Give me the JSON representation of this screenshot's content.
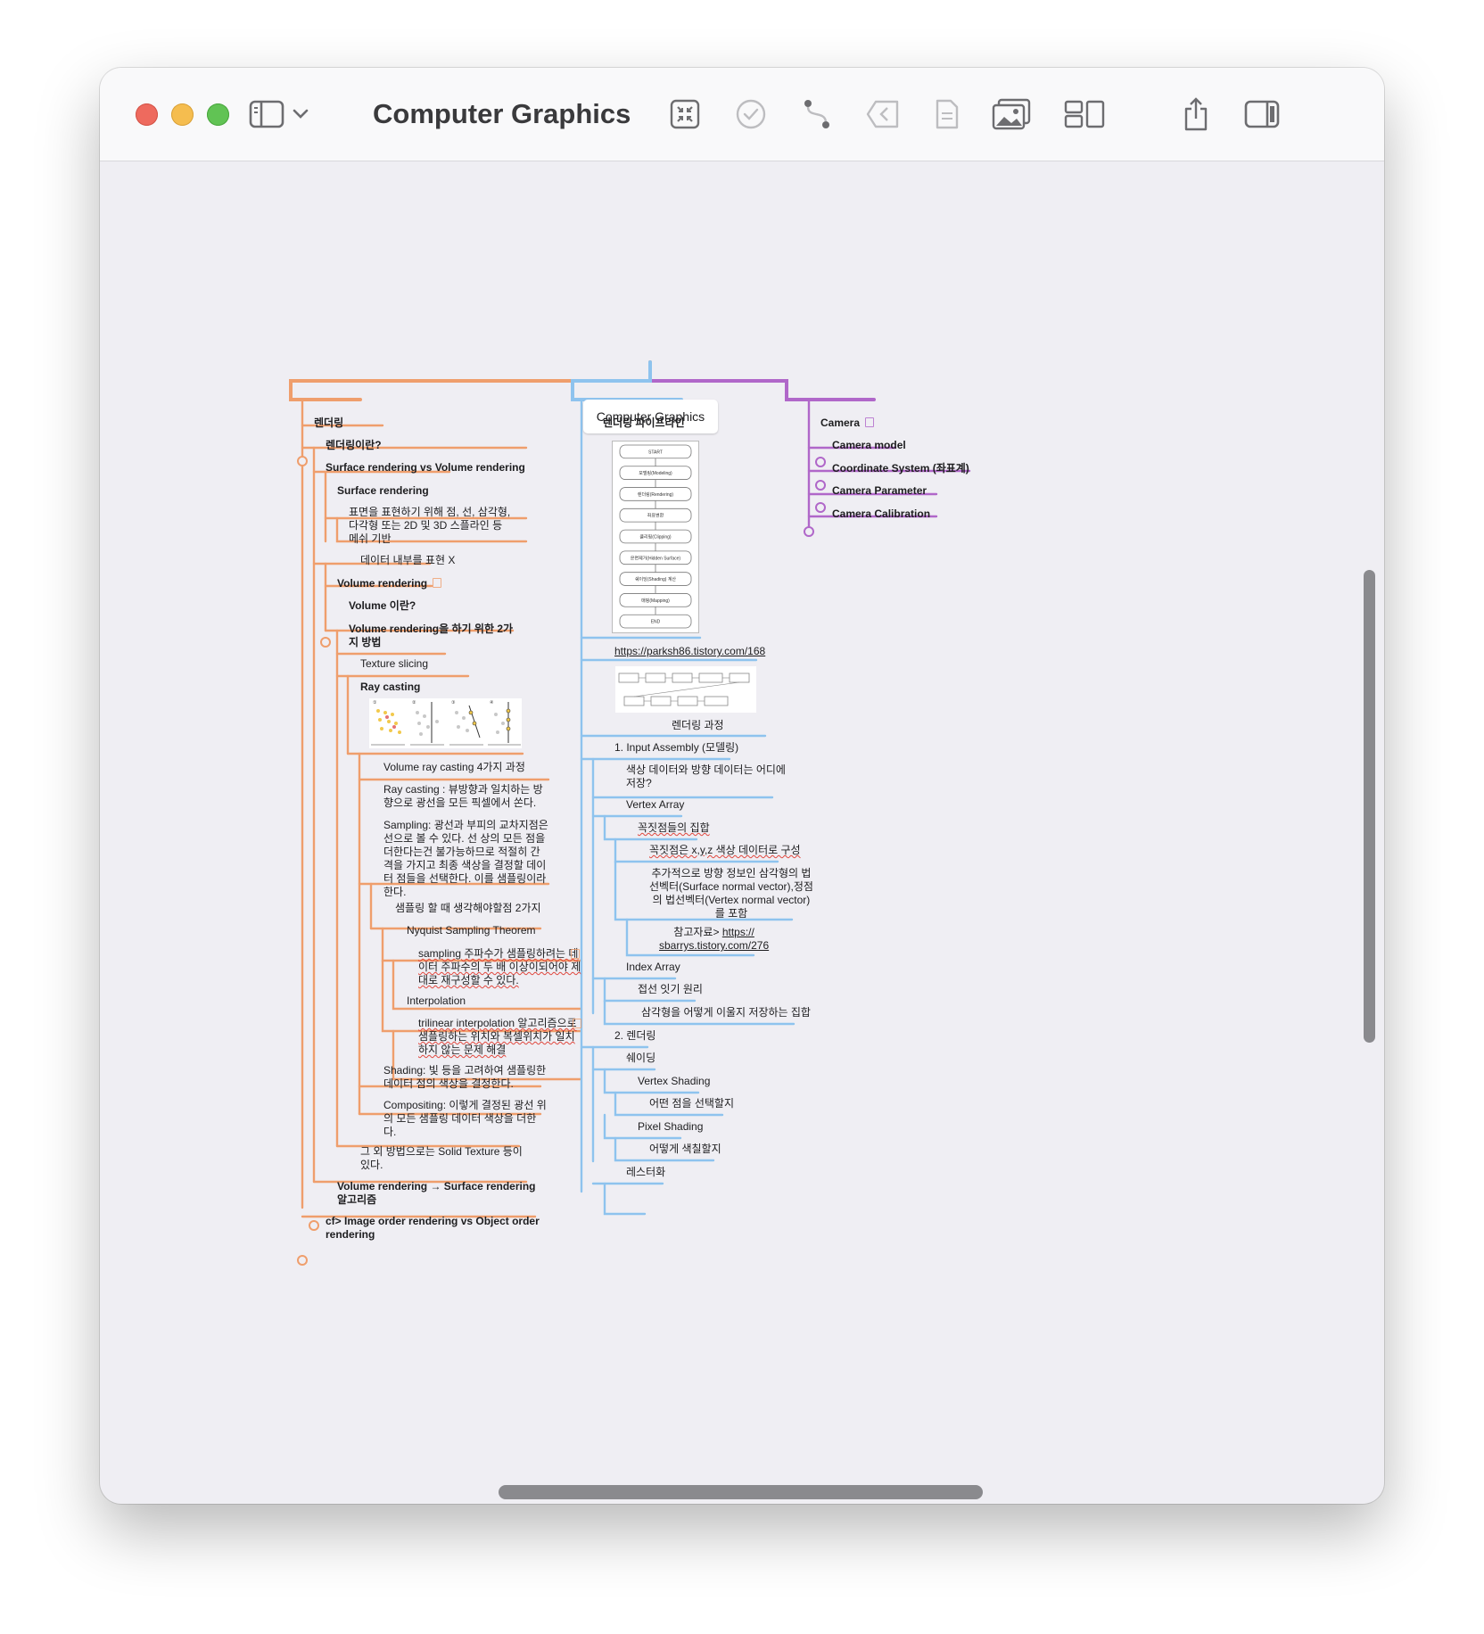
{
  "window": {
    "title": "Computer Graphics",
    "toolbar": [
      "sidebar-icon",
      "chevron-down-icon",
      "focus-icon",
      "checkmark-icon",
      "relationship-icon",
      "back-icon",
      "note-icon",
      "image-icon",
      "layout-icon",
      "share-icon",
      "inspector-icon"
    ]
  },
  "colors": {
    "orange": "#ef9e6c",
    "blue": "#8ec3ee",
    "purple": "#b067c9",
    "bg": "#efeef3"
  },
  "map": {
    "root": "Computer Graphics",
    "rendering": {
      "title": "렌더링",
      "what_is": "렌더링이란?",
      "surface_vs_volume": "Surface rendering vs Volume rendering",
      "surface_rendering": "Surface rendering",
      "surface_desc": "표면을 표현하기 위해 점, 선, 삼각형,\n다각형 또는 2D 및 3D 스플라인 등\n메쉬 기반",
      "surface_note": "데이터 내부를 표현 X",
      "volume_rendering": "Volume rendering",
      "volume_what": "Volume 이란?",
      "volume_methods": "Volume rendering을 하기 위한 2가\n지 방법",
      "texture_slicing": "Texture slicing",
      "ray_casting": "Ray casting",
      "ray_caption": "Volume ray casting 4가지 과정",
      "ray_def": "Ray casting : 뷰방향과 일치하는 방\n향으로 광선을 모든 픽셀에서 쏜다.",
      "sampling": "Sampling: 광선과 부피의 교차지점은\n선으로 볼 수 있다. 선 상의 모든 점을\n더한다는건 불가능하므로 적절히 간\n격을 가지고 최종 색상을 결정할 데이\n터 점들을 선택한다. 이를 샘플링이라\n한다.",
      "sampling_two": "샘플링 할 때 생각해야할점 2가지",
      "nyquist": "Nyquist Sampling Theorem",
      "nyquist_desc": "sampling 주파수가 샘플링하려는 데\n이터 주파수의 두 배 이상이되어야 제\n대로 재구성할 수 있다.",
      "interpolation": "Interpolation",
      "interp_desc": "trilinear interpolation 알고리즘으로\n샘플링하는 위치와 복셀위치가 일치\n하지 않는 문제 해결",
      "shading": "Shading: 빛 등을 고려하여 샘플링한\n데이터 점의 색상을 결정한다.",
      "compositing": "Compositing: 이렇게 결정된 광선 위\n의 모든 샘플링 데이터 색상을 더한\n다.",
      "other_methods": "그 외 방법으로는 Solid Texture 등이\n있다.",
      "vol_to_surf": "Volume rendering → Surface rendering\n알고리즘",
      "image_vs_object": "cf> Image order rendering vs Object order\nrendering"
    },
    "pipeline": {
      "title": "렌더링 파이프라인",
      "flow_items": [
        "START",
        "모델링(Modeling)",
        "렌더링(Rendering)",
        "좌표변환",
        "클리핑(Clipping)",
        "은면제거(Hidden Surface)",
        "쉐이딩(Shading) 계산",
        "매핑(Mapping)",
        "END"
      ],
      "link": "https://parksh86.tistory.com/168",
      "process_caption": "렌더링 과정",
      "input_assembly": "1. Input Assembly (모델링)",
      "where_stored": "색상 데이터와 방향 데이터는 어디에\n저장?",
      "vertex_array": "Vertex Array",
      "vertex_set": "꼭짓점들의 집합",
      "vertex_xyz": "꼭짓점은 x,y,z 색상 데이터로 구성",
      "normals": "추가적으로 방향 정보인 삼각형의 법\n선벡터(Surface normal vector),정점\n의 법선벡터(Vertex normal vector)\n를 포함",
      "ref_prefix": "참고자료> ",
      "ref_link": "https://\nsbarrys.tistory.com/276",
      "index_array": "Index Array",
      "connect": "접선 잇기 원리",
      "triangle_set": "삼각형을 어떻게 이울지 저장하는 집합",
      "render2": "2. 렌더링",
      "shading": "쉐이딩",
      "vertex_shading": "Vertex Shading",
      "which_point": "어떤 점을 선택할지",
      "pixel_shading": "Pixel Shading",
      "how_color": "어떻게 색칠할지",
      "raster": "레스터화"
    },
    "camera": {
      "title": "Camera",
      "items": [
        "Camera model",
        "Coordinate System (좌표계)",
        "Camera Parameter",
        "Camera Calibration"
      ]
    }
  }
}
